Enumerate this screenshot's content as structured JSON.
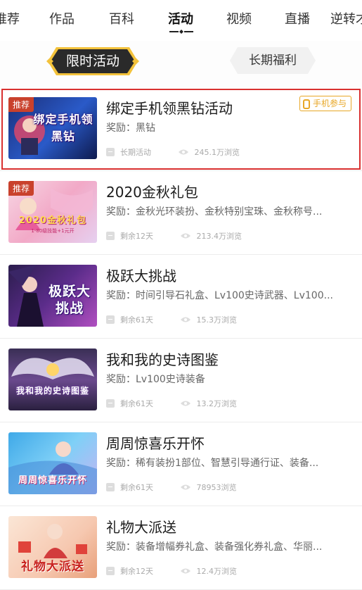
{
  "tabs": [
    {
      "label": "推荐",
      "active": false
    },
    {
      "label": "作品",
      "active": false
    },
    {
      "label": "百科",
      "active": false
    },
    {
      "label": "活动",
      "active": true
    },
    {
      "label": "视频",
      "active": false
    },
    {
      "label": "直播",
      "active": false
    },
    {
      "label": "逆转才",
      "active": false
    }
  ],
  "segments": {
    "left": "限时活动",
    "right": "长期福利"
  },
  "items": [
    {
      "badge": "推荐",
      "image_text": "绑定手机领黑钻",
      "title": "绑定手机领黑钻活动",
      "reward": "奖励：黑钻",
      "time": "长期活动",
      "views": "245.1万浏览",
      "tag": "手机参与"
    },
    {
      "badge": "推荐",
      "image_text": "2020金秋礼包",
      "image_sub": "1-80级技能+1元开",
      "title": "2020金秋礼包",
      "reward": "奖励：金秋光环装扮、金秋特别宝珠、金秋称号...",
      "time": "剩余12天",
      "views": "213.4万浏览"
    },
    {
      "image_text": "极跃大挑战",
      "title": "极跃大挑战",
      "reward": "奖励：时间引导石礼盒、Lv100史诗武器、Lv100...",
      "time": "剩余61天",
      "views": "15.3万浏览"
    },
    {
      "image_text": "我和我的史诗图鉴",
      "title": "我和我的史诗图鉴",
      "reward": "奖励：Lv100史诗装备",
      "time": "剩余61天",
      "views": "13.2万浏览"
    },
    {
      "image_text": "周周惊喜乐开怀",
      "title": "周周惊喜乐开怀",
      "reward": "奖励：稀有装扮1部位、智慧引导通行证、装备...",
      "time": "剩余61天",
      "views": "78953浏览"
    },
    {
      "image_text": "礼物大派送",
      "title": "礼物大派送",
      "reward": "奖励：装备增幅券礼盒、装备强化券礼盒、华丽...",
      "time": "剩余12天",
      "views": "12.4万浏览"
    }
  ],
  "colors": {
    "accent_gold": "#e8a726",
    "badge_red": "#c9412c",
    "highlight_border": "#d9302f",
    "segment_active_bg": "#2a2a2a"
  }
}
